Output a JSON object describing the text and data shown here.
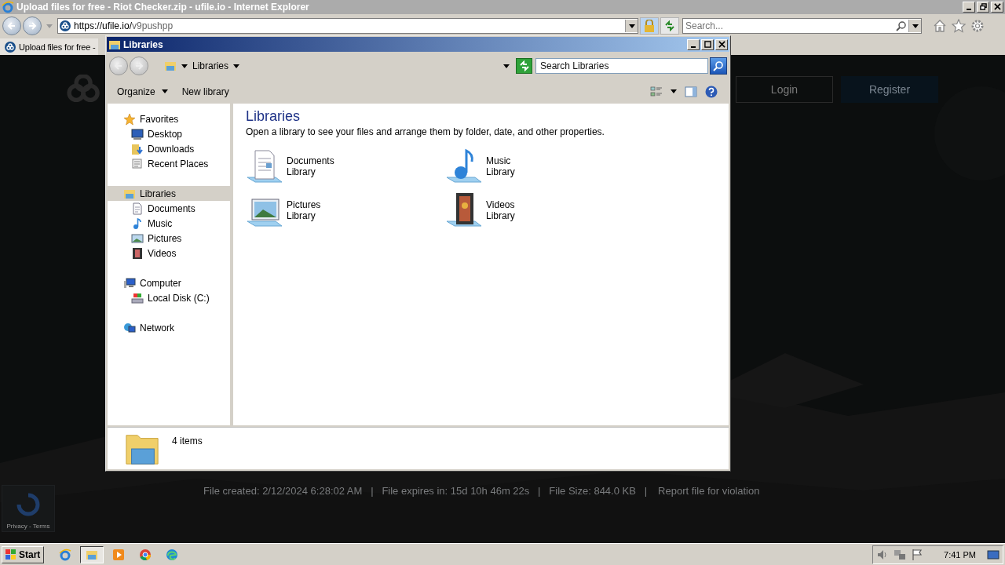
{
  "browser": {
    "title": "Upload files for free - Riot Checker.zip - ufile.io - Internet Explorer",
    "url_host": "https://ufile.io/",
    "url_path": "v9pushpp",
    "search": {
      "placeholder": "Search..."
    },
    "tab": {
      "label": "Upload files for free -",
      "selected": true
    }
  },
  "page": {
    "login": "Login",
    "register": "Register",
    "footer_info": "File created: 2/12/2024 6:28:02 AM   |   File expires in: 15d 10h 46m 22s   |   File Size: 844.0 KB   |",
    "footer_link": "Report file for violation",
    "recaptcha": "Privacy - Terms"
  },
  "explorer": {
    "title": "Libraries",
    "breadcrumb": "Libraries",
    "search": {
      "placeholder": "Search Libraries"
    },
    "toolbar": [
      "Organize",
      "New library"
    ],
    "nav": [
      {
        "label": "Favorites",
        "kind": "star",
        "selected": false,
        "children": [
          {
            "label": "Desktop",
            "kind": "desktop",
            "selected": false
          },
          {
            "label": "Downloads",
            "kind": "downloads",
            "selected": false
          },
          {
            "label": "Recent Places",
            "kind": "recent",
            "selected": false
          }
        ]
      },
      {
        "label": "Libraries",
        "kind": "library",
        "selected": true,
        "children": [
          {
            "label": "Documents",
            "kind": "document",
            "selected": false
          },
          {
            "label": "Music",
            "kind": "music",
            "selected": false
          },
          {
            "label": "Pictures",
            "kind": "picture",
            "selected": false
          },
          {
            "label": "Videos",
            "kind": "video",
            "selected": false
          }
        ]
      },
      {
        "label": "Computer",
        "kind": "computer",
        "selected": false,
        "children": [
          {
            "label": "Local Disk (C:)",
            "kind": "disk",
            "selected": false
          }
        ]
      },
      {
        "label": "Network",
        "kind": "network",
        "selected": false
      }
    ],
    "heading": "Libraries",
    "description": "Open a library to see your files and arrange them by folder, date, and other properties.",
    "libraries": [
      {
        "name": "Documents",
        "sub": "Library",
        "kind": "document"
      },
      {
        "name": "Music",
        "sub": "Library",
        "kind": "music"
      },
      {
        "name": "Pictures",
        "sub": "Library",
        "kind": "picture"
      },
      {
        "name": "Videos",
        "sub": "Library",
        "kind": "video"
      }
    ],
    "status": "4 items"
  },
  "taskbar": {
    "start": "Start",
    "clock": "7:41 PM",
    "apps": [
      {
        "kind": "ie",
        "selected": false
      },
      {
        "kind": "explorer",
        "selected": true
      },
      {
        "kind": "media",
        "selected": false
      },
      {
        "kind": "chrome",
        "selected": false
      },
      {
        "kind": "edge",
        "selected": false
      }
    ]
  }
}
